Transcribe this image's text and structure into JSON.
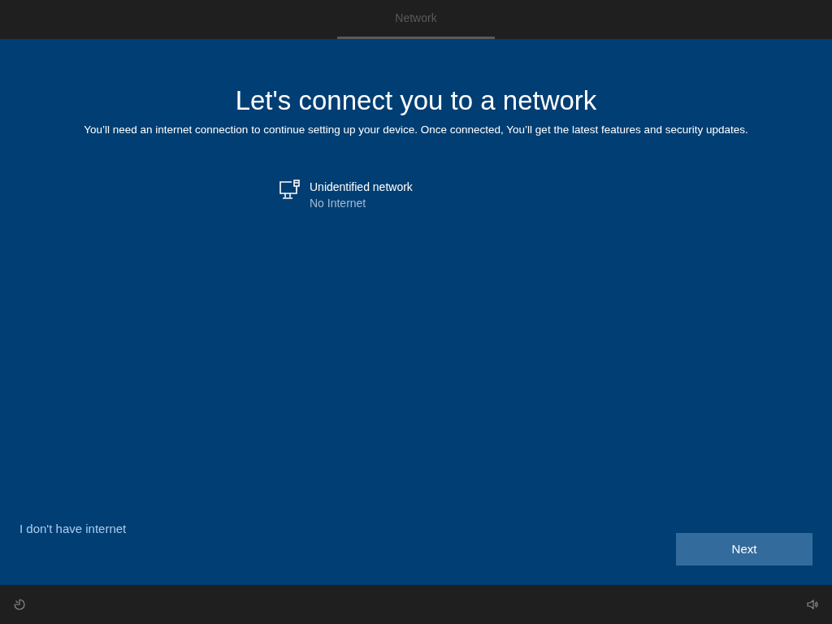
{
  "header": {
    "tabs": [
      {
        "label": "Network",
        "selected": true
      }
    ]
  },
  "title": "Let's connect you to a network",
  "subtitle": "You’ll need an internet connection to continue setting up your device. Once connected, You’ll get the latest features and security updates.",
  "networks": [
    {
      "name": "Unidentified network",
      "status": "No Internet"
    }
  ],
  "skip_link": "I don't have internet",
  "next_button": "Next"
}
